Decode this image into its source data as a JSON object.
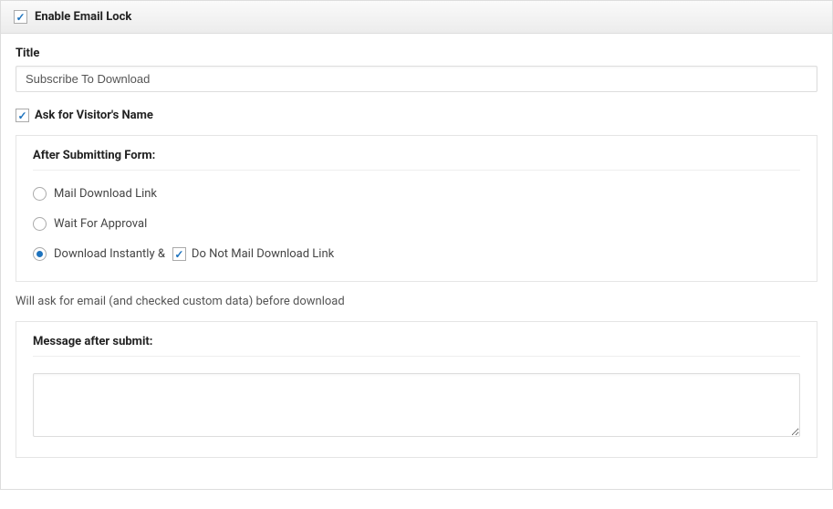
{
  "header": {
    "enable_label": "Enable Email Lock",
    "enabled": true
  },
  "title_field": {
    "label": "Title",
    "value": "Subscribe To Download"
  },
  "ask_name": {
    "label": "Ask for Visitor's Name",
    "checked": true
  },
  "after_submit": {
    "title": "After Submitting Form:",
    "options": [
      {
        "label": "Mail Download Link",
        "selected": false
      },
      {
        "label": "Wait For Approval",
        "selected": false
      },
      {
        "label_prefix": "Download Instantly & ",
        "selected": true,
        "sub_checkbox": {
          "label": "Do Not Mail Download Link",
          "checked": true
        }
      }
    ]
  },
  "help_text": "Will ask for email (and checked custom data) before download",
  "message_after": {
    "title": "Message after submit:",
    "value": ""
  }
}
